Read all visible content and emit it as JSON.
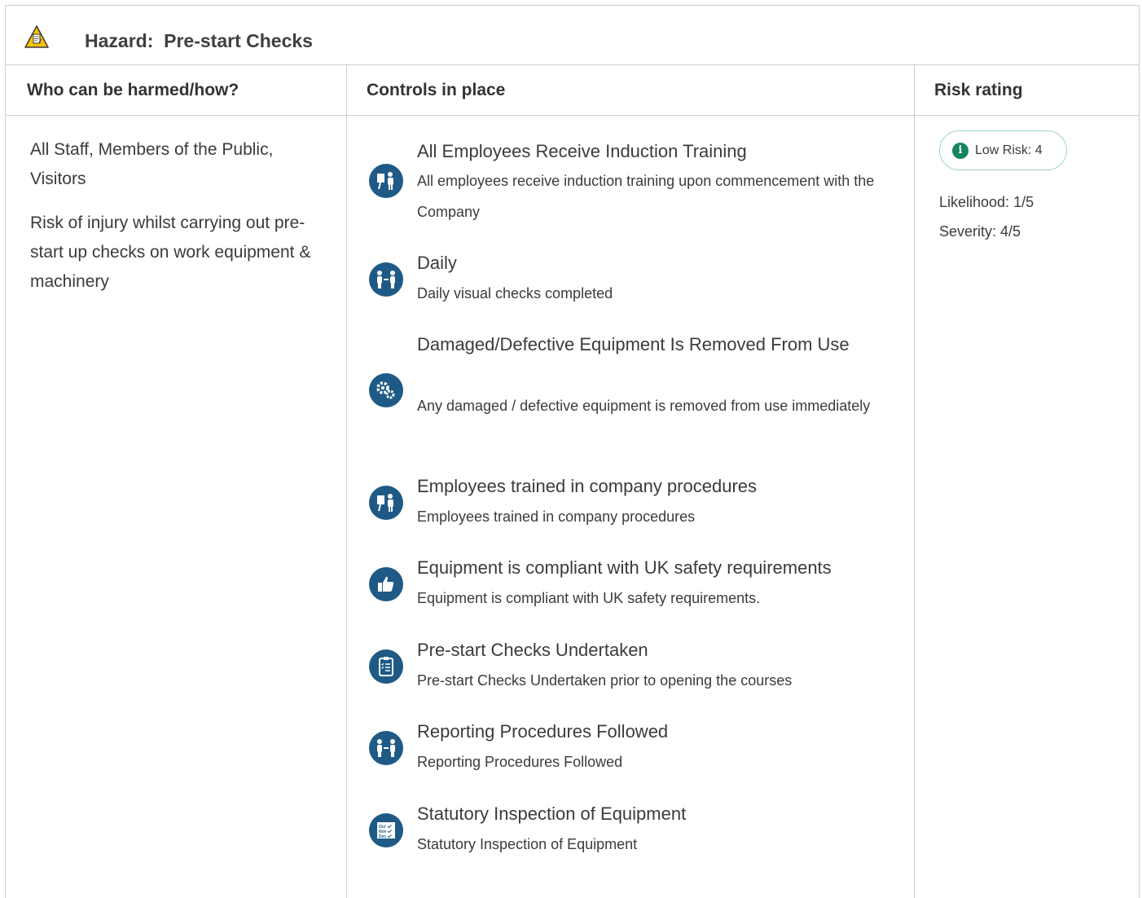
{
  "hazard": {
    "label": "Hazard:",
    "name": "Pre-start Checks",
    "icon": "hazard-warning-icon"
  },
  "columns": {
    "who": "Who can be harmed/how?",
    "controls": "Controls in place",
    "risk": "Risk rating"
  },
  "harm": {
    "who": "All Staff, Members of the Public, Visitors",
    "how": "Risk of injury whilst carrying out pre-start up checks on work equipment & machinery"
  },
  "controls": [
    {
      "title": "All Employees Receive Induction Training",
      "desc": "All employees receive induction training upon commencement with the Company",
      "icon": "training-presentation-icon"
    },
    {
      "title": "Daily",
      "desc": "Daily visual checks completed",
      "icon": "people-exchange-icon"
    },
    {
      "title": "Damaged/Defective Equipment Is Removed From Use",
      "desc": "Any damaged / defective equipment is removed from use immediately",
      "icon": "cogs-icon"
    },
    {
      "title": "Employees trained in company procedures",
      "desc": "Employees trained in company procedures",
      "icon": "training-presentation-icon"
    },
    {
      "title": "Equipment is compliant with UK safety requirements",
      "desc": "Equipment is compliant with UK safety requirements.",
      "icon": "thumbs-up-icon"
    },
    {
      "title": "Pre-start Checks Undertaken",
      "desc": "Pre-start Checks Undertaken prior to opening the courses",
      "icon": "checklist-clipboard-icon"
    },
    {
      "title": "Reporting Procedures Followed",
      "desc": "Reporting Procedures Followed",
      "icon": "people-exchange-icon"
    },
    {
      "title": "Statutory Inspection of Equipment",
      "desc": "Statutory Inspection of Equipment",
      "icon": "calendar-checklist-icon"
    }
  ],
  "risk": {
    "badge": "Low Risk: 4",
    "likelihood": "Likelihood: 1/5",
    "severity": "Severity: 4/5",
    "color": "#16865c"
  },
  "colors": {
    "icon_bg": "#1f5a86",
    "border": "#cfcfcf"
  }
}
